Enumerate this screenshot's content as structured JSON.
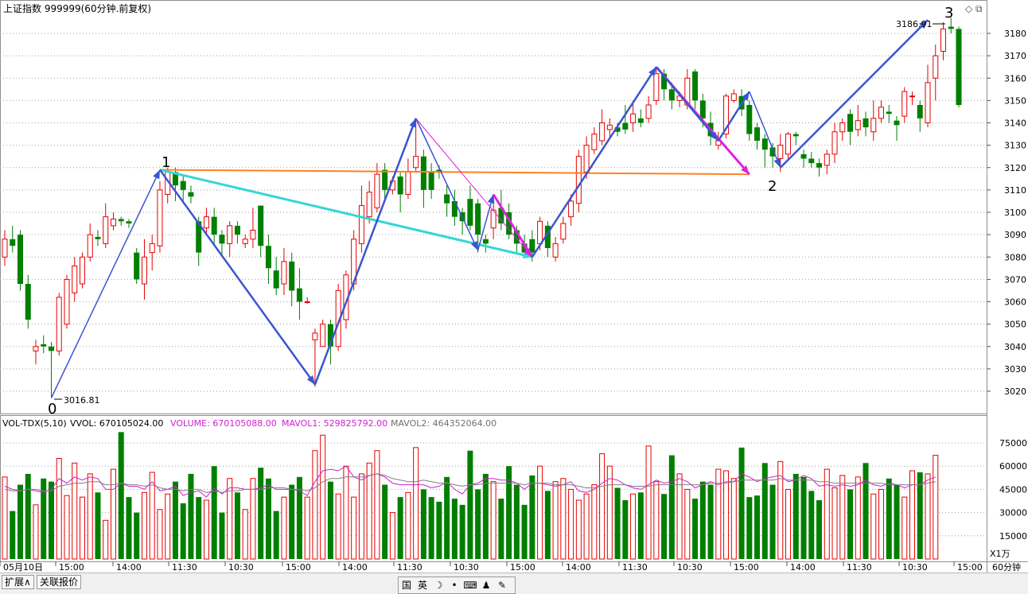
{
  "header": {
    "title": "上证指数 999999(60分钟.前复权)",
    "period_label": "60分钟",
    "unit_label": "X1万"
  },
  "vol_header": {
    "name": "VOL-TDX(5,10)",
    "vvol": "VVOL: 670105024.00",
    "volume": "VOLUME: 670105088.00",
    "mavol1": "MAVOL1: 529825792.00",
    "mavol2": "MAVOL2: 464352064.00"
  },
  "colors": {
    "up": "#e60000",
    "down": "#007f00",
    "wave": "#3a55d0",
    "cyan": "#33d6d6",
    "magenta": "#e020e0",
    "orange": "#ff8020",
    "mavol1": "#d020d0",
    "mavol2": "#808080"
  },
  "tabs": [
    "扩展∧",
    "关联报价"
  ],
  "ime": [
    "国",
    "英",
    "moon-icon",
    "dot-icon",
    "keyboard-icon",
    "user-icon",
    "wrench-icon"
  ],
  "chart_data": {
    "type": "candlestick",
    "price_axis": {
      "min": 3010,
      "max": 3185,
      "ticks": [
        3020,
        3030,
        3040,
        3050,
        3060,
        3070,
        3080,
        3090,
        3100,
        3110,
        3120,
        3130,
        3140,
        3150,
        3160,
        3170,
        3180
      ]
    },
    "volume_axis": {
      "min": 0,
      "max": 82000,
      "ticks": [
        15000,
        30000,
        45000,
        60000,
        75000
      ],
      "unit": "X1万"
    },
    "time_labels": [
      "05月10日",
      "15:00",
      "14:00",
      "11:30",
      "10:30",
      "15:00",
      "14:00",
      "11:30",
      "10:30",
      "15:00",
      "14:00",
      "11:30",
      "10:30",
      "15:00",
      "14:00",
      "11:30",
      "10:30",
      "15:00"
    ],
    "annotations": {
      "wave_points": [
        "0",
        "1",
        "2",
        "3"
      ],
      "low_price_label": "3016.81",
      "high_price_label": "3186.91"
    },
    "candles": [
      [
        3080,
        3088,
        3076,
        3092
      ],
      [
        3088,
        3085,
        3082,
        3094
      ],
      [
        3090,
        3068,
        3065,
        3092
      ],
      [
        3068,
        3052,
        3048,
        3072
      ],
      [
        3038,
        3040,
        3032,
        3043
      ],
      [
        3041,
        3040,
        3037,
        3045
      ],
      [
        3040,
        3038,
        3017,
        3042
      ],
      [
        3038,
        3062,
        3036,
        3064
      ],
      [
        3050,
        3070,
        3048,
        3072
      ],
      [
        3064,
        3076,
        3060,
        3080
      ],
      [
        3068,
        3080,
        3066,
        3082
      ],
      [
        3080,
        3090,
        3078,
        3095
      ],
      [
        3089,
        3088,
        3085,
        3092
      ],
      [
        3086,
        3098,
        3084,
        3104
      ],
      [
        3094,
        3097,
        3092,
        3100
      ],
      [
        3097,
        3096,
        3094,
        3098
      ],
      [
        3096,
        3095,
        3093,
        3097
      ],
      [
        3082,
        3070,
        3068,
        3084
      ],
      [
        3068,
        3080,
        3061,
        3088
      ],
      [
        3082,
        3086,
        3074,
        3090
      ],
      [
        3085,
        3110,
        3082,
        3114
      ],
      [
        3108,
        3118,
        3104,
        3120
      ],
      [
        3118,
        3112,
        3105,
        3120
      ],
      [
        3114,
        3110,
        3104,
        3116
      ],
      [
        3109,
        3107,
        3104,
        3112
      ],
      [
        3096,
        3082,
        3076,
        3098
      ],
      [
        3093,
        3098,
        3090,
        3102
      ],
      [
        3098,
        3090,
        3086,
        3102
      ],
      [
        3090,
        3086,
        3080,
        3092
      ],
      [
        3086,
        3094,
        3080,
        3096
      ],
      [
        3094,
        3090,
        3086,
        3096
      ],
      [
        3086,
        3088,
        3084,
        3090
      ],
      [
        3088,
        3092,
        3084,
        3102
      ],
      [
        3103,
        3085,
        3080,
        3103
      ],
      [
        3085,
        3075,
        3068,
        3090
      ],
      [
        3074,
        3066,
        3063,
        3080
      ],
      [
        3068,
        3078,
        3063,
        3084
      ],
      [
        3078,
        3065,
        3058,
        3082
      ],
      [
        3066,
        3060,
        3052,
        3075
      ],
      [
        3060,
        3060,
        3059,
        3062
      ],
      [
        3043,
        3046,
        3022,
        3048
      ],
      [
        3040,
        3050,
        3040,
        3052
      ],
      [
        3050,
        3040,
        3032,
        3052
      ],
      [
        3040,
        3065,
        3038,
        3068
      ],
      [
        3052,
        3072,
        3048,
        3074
      ],
      [
        3068,
        3088,
        3065,
        3092
      ],
      [
        3086,
        3103,
        3082,
        3112
      ],
      [
        3098,
        3109,
        3095,
        3114
      ],
      [
        3102,
        3117,
        3100,
        3122
      ],
      [
        3119,
        3110,
        3105,
        3122
      ],
      [
        3110,
        3114,
        3108,
        3116
      ],
      [
        3116,
        3108,
        3100,
        3118
      ],
      [
        3108,
        3118,
        3106,
        3124
      ],
      [
        3120,
        3125,
        3118,
        3142
      ],
      [
        3125,
        3110,
        3102,
        3128
      ],
      [
        3118,
        3110,
        3106,
        3122
      ],
      [
        3119,
        3118,
        3115,
        3121
      ],
      [
        3108,
        3104,
        3098,
        3112
      ],
      [
        3105,
        3098,
        3094,
        3110
      ],
      [
        3100,
        3096,
        3090,
        3102
      ],
      [
        3106,
        3094,
        3092,
        3112
      ],
      [
        3104,
        3090,
        3082,
        3106
      ],
      [
        3088,
        3086,
        3082,
        3090
      ],
      [
        3093,
        3101,
        3088,
        3106
      ],
      [
        3102,
        3095,
        3092,
        3110
      ],
      [
        3100,
        3090,
        3088,
        3104
      ],
      [
        3092,
        3086,
        3082,
        3094
      ],
      [
        3086,
        3082,
        3080,
        3090
      ],
      [
        3088,
        3082,
        3078,
        3092
      ],
      [
        3086,
        3096,
        3083,
        3098
      ],
      [
        3094,
        3084,
        3080,
        3096
      ],
      [
        3080,
        3086,
        3078,
        3089
      ],
      [
        3088,
        3095,
        3086,
        3098
      ],
      [
        3098,
        3105,
        3094,
        3108
      ],
      [
        3104,
        3125,
        3100,
        3128
      ],
      [
        3118,
        3130,
        3115,
        3134
      ],
      [
        3128,
        3135,
        3126,
        3138
      ],
      [
        3132,
        3140,
        3130,
        3146
      ],
      [
        3137,
        3139,
        3133,
        3142
      ],
      [
        3138,
        3136,
        3134,
        3140
      ],
      [
        3140,
        3137,
        3135,
        3148
      ],
      [
        3140,
        3144,
        3136,
        3150
      ],
      [
        3142,
        3140,
        3138,
        3146
      ],
      [
        3142,
        3148,
        3140,
        3152
      ],
      [
        3150,
        3162,
        3148,
        3165
      ],
      [
        3162,
        3155,
        3150,
        3164
      ],
      [
        3155,
        3150,
        3146,
        3158
      ],
      [
        3150,
        3152,
        3147,
        3154
      ],
      [
        3148,
        3160,
        3146,
        3164
      ],
      [
        3163,
        3150,
        3146,
        3164
      ],
      [
        3150,
        3142,
        3138,
        3153
      ],
      [
        3140,
        3134,
        3130,
        3145
      ],
      [
        3130,
        3132,
        3128,
        3136
      ],
      [
        3135,
        3152,
        3133,
        3153
      ],
      [
        3150,
        3153,
        3149,
        3155
      ],
      [
        3152,
        3146,
        3143,
        3155
      ],
      [
        3148,
        3135,
        3132,
        3150
      ],
      [
        3138,
        3132,
        3128,
        3140
      ],
      [
        3133,
        3128,
        3120,
        3135
      ],
      [
        3129,
        3125,
        3120,
        3131
      ],
      [
        3124,
        3130,
        3118,
        3135
      ],
      [
        3126,
        3135,
        3124,
        3136
      ],
      [
        3135,
        3134,
        3130,
        3136
      ],
      [
        3126,
        3124,
        3120,
        3128
      ],
      [
        3124,
        3122,
        3120,
        3127
      ],
      [
        3122,
        3120,
        3116,
        3124
      ],
      [
        3121,
        3126,
        3117,
        3128
      ],
      [
        3126,
        3136,
        3122,
        3140
      ],
      [
        3136,
        3140,
        3132,
        3142
      ],
      [
        3144,
        3136,
        3130,
        3146
      ],
      [
        3137,
        3141,
        3134,
        3148
      ],
      [
        3142,
        3138,
        3134,
        3145
      ],
      [
        3136,
        3142,
        3132,
        3150
      ],
      [
        3142,
        3147,
        3140,
        3150
      ],
      [
        3145,
        3144,
        3140,
        3148
      ],
      [
        3141,
        3139,
        3132,
        3143
      ],
      [
        3143,
        3154,
        3140,
        3156
      ],
      [
        3152,
        3152,
        3148,
        3154
      ],
      [
        3148,
        3142,
        3136,
        3150
      ],
      [
        3140,
        3158,
        3138,
        3166
      ],
      [
        3160,
        3170,
        3150,
        3175
      ],
      [
        3172,
        3182,
        3168,
        3185
      ],
      [
        3183,
        3182,
        3180,
        3187
      ],
      [
        3182,
        3148,
        3147,
        3183
      ]
    ],
    "volumes": [
      53000,
      31000,
      48000,
      55000,
      35000,
      52000,
      50000,
      65000,
      41000,
      62000,
      40000,
      55000,
      43000,
      25000,
      58000,
      82000,
      40000,
      30000,
      43000,
      56000,
      32000,
      42000,
      50000,
      36000,
      55000,
      40000,
      38000,
      60000,
      30000,
      52000,
      43000,
      32000,
      52000,
      59000,
      52000,
      31000,
      40000,
      48000,
      53000,
      40000,
      70000,
      80000,
      50000,
      42000,
      60000,
      40000,
      55000,
      62000,
      70000,
      48000,
      30000,
      40000,
      43000,
      72000,
      45000,
      40000,
      37000,
      53000,
      39000,
      35000,
      70000,
      45000,
      55000,
      50000,
      39000,
      60000,
      48000,
      35000,
      54000,
      60000,
      44000,
      50000,
      52000,
      45000,
      38000,
      42000,
      48000,
      68000,
      60000,
      46000,
      38000,
      42000,
      43000,
      73000,
      50000,
      42000,
      67000,
      55000,
      45000,
      39000,
      50000,
      48000,
      58000,
      57000,
      52000,
      72000,
      40000,
      41000,
      62000,
      48000,
      63000,
      45000,
      55000,
      53000,
      44000,
      38000,
      58000,
      46000,
      54000,
      45000,
      53000,
      62000,
      42000,
      45000,
      52000,
      48000,
      40000,
      57000,
      56000,
      55000,
      67000
    ],
    "mavol1": [
      47000,
      45000,
      44000,
      45000,
      44000,
      43000,
      45000,
      52000,
      49000,
      53000,
      51000,
      53000,
      52000,
      45000,
      45000,
      49000,
      47000,
      47000,
      45000,
      50000,
      44000,
      45000,
      47000,
      41000,
      43000,
      44000,
      40000,
      46000,
      42000,
      46000,
      46000,
      45000,
      45000,
      46000,
      48000,
      45000,
      45000,
      45000,
      44000,
      41000,
      50000,
      57000,
      58000,
      57000,
      60000,
      53000,
      51000,
      54000,
      55000,
      53000,
      49000,
      48000,
      48000,
      48000,
      48000,
      46000,
      47000,
      50000,
      45000,
      42000,
      48000,
      49000,
      52000,
      52000,
      51000,
      51000,
      49000,
      45000,
      49000,
      49000,
      48000,
      47000,
      48000,
      50000,
      44000,
      43000,
      45000,
      49000,
      52000,
      51000,
      48000,
      46000,
      45000,
      48000,
      51000,
      49000,
      50000,
      52000,
      50000,
      46000,
      48000,
      50000,
      48000,
      50000,
      50000,
      55000,
      53000,
      50000,
      52000,
      53000,
      54000,
      50000,
      51000,
      54000,
      52000,
      47000,
      48000,
      47000,
      48000,
      47000,
      48000,
      51000,
      48000,
      47000,
      49000,
      48000,
      46000,
      48000,
      48000,
      51000,
      53000
    ],
    "mavol2": [
      45000,
      44000,
      44000,
      45000,
      45000,
      44000,
      44000,
      47000,
      48000,
      49000,
      49000,
      50000,
      50000,
      48000,
      48000,
      49000,
      48000,
      48000,
      47000,
      48000,
      46000,
      45000,
      45000,
      44000,
      45000,
      45000,
      43000,
      44000,
      43000,
      44000,
      44000,
      45000,
      45000,
      45000,
      46000,
      46000,
      46000,
      45000,
      45000,
      44000,
      46000,
      50000,
      52000,
      52000,
      53000,
      53000,
      53000,
      54000,
      55000,
      54000,
      52000,
      51000,
      50000,
      50000,
      51000,
      50000,
      49000,
      49000,
      48000,
      47000,
      48000,
      48000,
      49000,
      49000,
      49000,
      49000,
      49000,
      48000,
      49000,
      49000,
      49000,
      48000,
      48000,
      48000,
      47000,
      46000,
      46000,
      47000,
      48000,
      48000,
      48000,
      47000,
      47000,
      47000,
      48000,
      48000,
      48000,
      48000,
      48000,
      48000,
      48000,
      49000,
      49000,
      49000,
      50000,
      51000,
      51000,
      51000,
      51000,
      51000,
      52000,
      51000,
      51000,
      51000,
      51000,
      50000,
      50000,
      49000,
      49000,
      49000,
      49000,
      49000,
      49000,
      49000,
      48000,
      48000,
      48000,
      48000,
      48000,
      49000,
      50000
    ]
  }
}
